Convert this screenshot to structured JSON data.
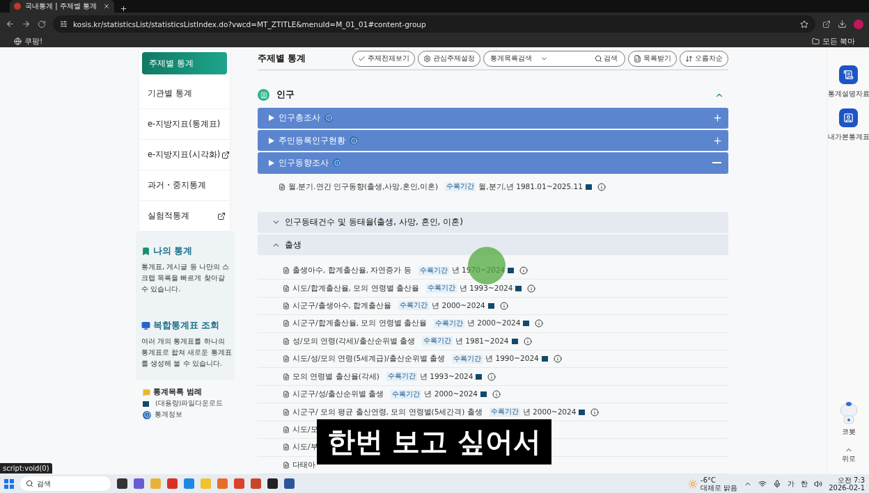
{
  "browser": {
    "tab_title": "국내통계 | 주제별 통계",
    "url": "kosis.kr/statisticsList/statisticsListIndex.do?vwcd=MT_ZTITLE&menuId=M_01_01#content-group",
    "bookmarks": [
      "쿠팡!"
    ],
    "bookmark_folder": "모든 북마"
  },
  "sidebar": {
    "menu": [
      {
        "label": "주제별 통계",
        "selected": true,
        "external": false
      },
      {
        "label": "기관별 통계",
        "selected": false,
        "external": false
      },
      {
        "label": "e-지방지표(통계표)",
        "selected": false,
        "external": false
      },
      {
        "label": "e-지방지표(시각화)",
        "selected": false,
        "external": true
      },
      {
        "label": "과거・중지통계",
        "selected": false,
        "external": false
      },
      {
        "label": "실험적통계",
        "selected": false,
        "external": true
      }
    ],
    "promos": [
      {
        "kind": "bookmark",
        "title": "나의 통계",
        "text": "통계표, 게시글 등 나만의 스크랩 목록을 빠르게 찾아갈 수 있습니다."
      },
      {
        "kind": "monitor",
        "title": "복합통계표 조회",
        "text": "여러 개의 통계표를 하나의 통계표로 합쳐 새로운 통계표를 생성해 볼 수 있습니다."
      }
    ],
    "legend": {
      "title": "통계목록 범례",
      "items": [
        {
          "kind": "download",
          "label": "(대용량)파일다운로드"
        },
        {
          "kind": "info",
          "label": "통계정보"
        }
      ]
    }
  },
  "main": {
    "title": "주제별 통계",
    "toolbar": [
      {
        "kind": "check",
        "label": "주제전체보기"
      },
      {
        "kind": "gear",
        "label": "관심주제설정"
      },
      {
        "kind": "search",
        "select": "통계목록검색",
        "label": "검색"
      },
      {
        "kind": "excel",
        "label": "목록받기"
      },
      {
        "kind": "sort",
        "label": "오름차순"
      }
    ],
    "category": {
      "title": "인구",
      "expanded": true
    },
    "groups": [
      {
        "label": "인구총조사",
        "expanded": false
      },
      {
        "label": "주민등록인구현황",
        "expanded": false
      },
      {
        "label": "인구동향조사",
        "expanded": true
      }
    ],
    "top_items": [
      {
        "title": "월.분기.연간 인구동향(출생,사망,혼인,이혼)",
        "period_label": "수록기간",
        "period": "월,분기,년 1981.01~2025.11"
      }
    ],
    "subgroups": [
      {
        "label": "인구동태건수 및 동태율(출생, 사망, 혼인, 이혼)",
        "expanded": false
      },
      {
        "label": "출생",
        "expanded": true
      }
    ],
    "items": [
      {
        "title": "출생아수, 합계출산율, 자연증가 등",
        "period_label": "수록기간",
        "period": "년 1970~2024"
      },
      {
        "title": "시도/합계출산율, 모의 연령별 출산율",
        "period_label": "수록기간",
        "period": "년 1993~2024"
      },
      {
        "title": "시군구/출생아수, 합계출산율",
        "period_label": "수록기간",
        "period": "년 2000~2024"
      },
      {
        "title": "시군구/합계출산율, 모의 연령별 출산율",
        "period_label": "수록기간",
        "period": "년 2000~2024"
      },
      {
        "title": "성/모의 연령(각세)/출산순위별 출생",
        "period_label": "수록기간",
        "period": "년 1981~2024"
      },
      {
        "title": "시도/성/모의 연령(5세계급)/출산순위별 출생",
        "period_label": "수록기간",
        "period": "년 1990~2024"
      },
      {
        "title": "모의 연령별 출산율(각세)",
        "period_label": "수록기간",
        "period": "년 1993~2024"
      },
      {
        "title": "시군구/성/출산순위별 출생",
        "period_label": "수록기간",
        "period": "년 2000~2024"
      },
      {
        "title": "시군구/ 모의 평균 출산연령, 모의 연령별(5세간격) 출생",
        "period_label": "수록기간",
        "period": "년 2000~2024"
      },
      {
        "title": "시도/모"
      },
      {
        "title": "시도/부"
      },
      {
        "title": "다태아"
      }
    ]
  },
  "right_rail": [
    {
      "kind": "doc",
      "label": "통계설명자료"
    },
    {
      "kind": "table",
      "label": "내가본통계표"
    }
  ],
  "chatbot": {
    "label": "코봇"
  },
  "top_button": {
    "label": "위로"
  },
  "caption": "한번 보고 싶어서",
  "status_url": "script:void(0)",
  "taskbar": {
    "search": "검색",
    "weather_temp": "-6°C",
    "weather_text": "대체로 맑음",
    "ime": [
      "가",
      "한"
    ],
    "time": "오전 7:3",
    "date": "2026-02-1"
  }
}
